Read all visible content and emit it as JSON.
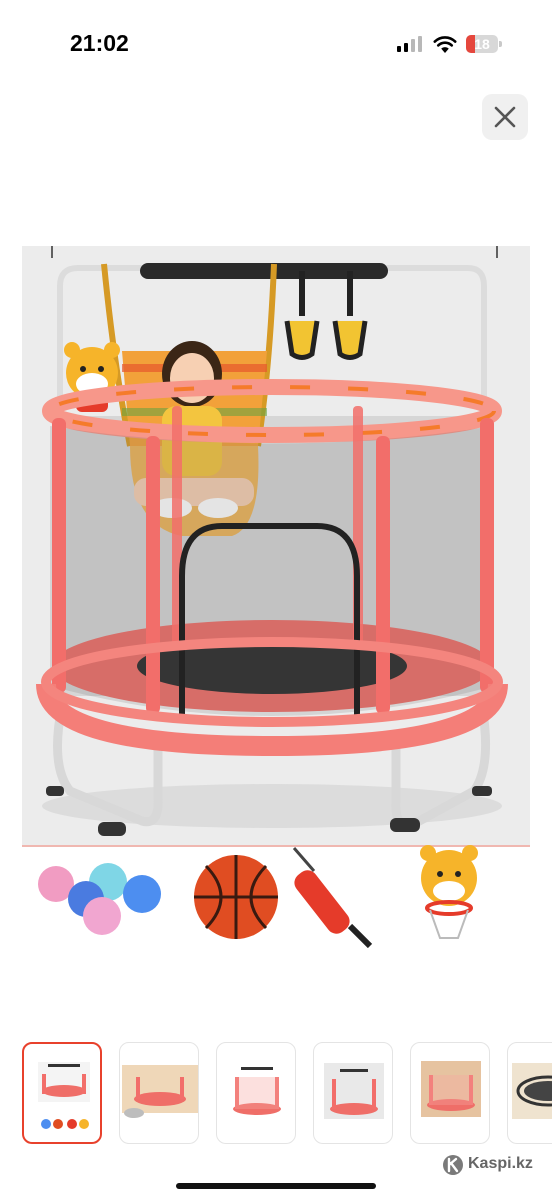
{
  "status_bar": {
    "time": "21:02",
    "battery_level": "18",
    "icons": [
      "signal-icon",
      "wifi-icon",
      "battery-icon"
    ]
  },
  "close_button": {
    "icon": "close-icon"
  },
  "gallery": {
    "main_image": "trampoline-with-swing-product-photo",
    "accessories": [
      "ball-pit-balls",
      "basketball",
      "hand-pump",
      "tiger-basketball-hoop"
    ],
    "thumbnails": [
      {
        "name": "thumb-1",
        "selected": true
      },
      {
        "name": "thumb-2",
        "selected": false
      },
      {
        "name": "thumb-3",
        "selected": false
      },
      {
        "name": "thumb-4",
        "selected": false
      },
      {
        "name": "thumb-5",
        "selected": false
      },
      {
        "name": "thumb-6",
        "selected": false
      }
    ]
  },
  "watermark": {
    "text": "Kaspi.kz"
  },
  "colors": {
    "accent": "#e8412c",
    "trampoline": "#f27d78",
    "frame_pad": "#ff9b8a",
    "net": "#4a4a4a"
  }
}
